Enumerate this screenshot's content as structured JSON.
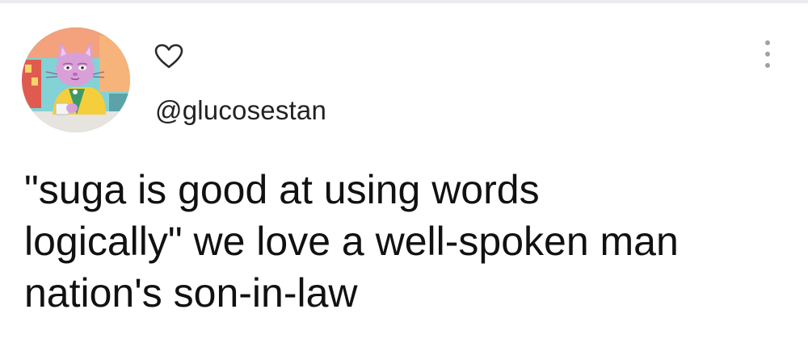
{
  "tweet": {
    "handle": "@glucosestan",
    "lines": [
      "\"suga is good at using words",
      "logically\" we love a well-spoken man",
      "nation's son-in-law"
    ]
  },
  "icons": {
    "like": "heart-outline-icon",
    "more": "vertical-ellipsis-icon",
    "avatar": "cartoon-pink-cat-avatar"
  },
  "colors": {
    "text": "#111111",
    "handle": "#222222",
    "icon_gray": "#9aa2aa",
    "background": "#ffffff"
  }
}
